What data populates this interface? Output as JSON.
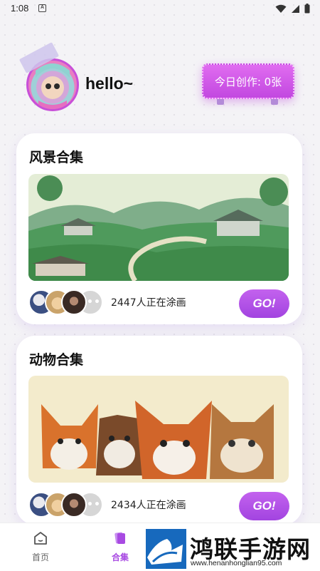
{
  "status_bar": {
    "time": "1:08",
    "notification_icon": "A"
  },
  "header": {
    "greeting": "hello~",
    "today_badge": "今日创作: 0张"
  },
  "collections": [
    {
      "title": "风景合集",
      "image_alt": "landscape-painting",
      "count_text": "2447人正在涂画",
      "go_label": "GO!"
    },
    {
      "title": "动物合集",
      "image_alt": "animals-painting",
      "count_text": "2434人正在涂画",
      "go_label": "GO!"
    }
  ],
  "more_label": "•••",
  "bottom_nav": [
    {
      "label": "首页",
      "active": false
    },
    {
      "label": "合集",
      "active": true
    }
  ],
  "watermark": {
    "text": "鸿联手游网",
    "url": "www.henanhonglian95.com"
  },
  "colors": {
    "accent": "#a84ae2",
    "badge": "#d35ee9",
    "background": "#f4f3f6"
  }
}
